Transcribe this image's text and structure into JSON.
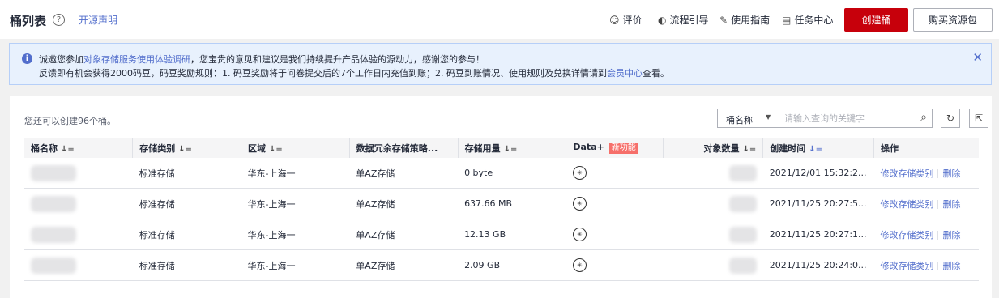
{
  "header": {
    "title": "桶列表",
    "help_icon": "question-circle-icon",
    "open_source_link": "开源声明",
    "toolbar": [
      {
        "icon": "smile-icon",
        "glyph": "☺",
        "label": "评价"
      },
      {
        "icon": "eye-off-icon",
        "glyph": "◐",
        "label": "流程引导"
      },
      {
        "icon": "edit-icon",
        "glyph": "✎",
        "label": "使用指南"
      },
      {
        "icon": "clipboard-icon",
        "glyph": "▤",
        "label": "任务中心"
      }
    ],
    "create_button": "创建桶",
    "buy_button": "购买资源包",
    "accent_color": "#c7000b"
  },
  "notice": {
    "icon": "info-circle-icon",
    "line1_prefix": "诚邀您参加",
    "line1_link": "对象存储服务使用体验调研",
    "line1_suffix": "，您宝贵的意见和建议是我们持续提升产品体验的源动力，感谢您的参与！",
    "line2_prefix": "反馈即有机会获得2000码豆，码豆奖励规则：1. 码豆奖励将于问卷提交后的7个工作日内充值到账；2. 码豆到账情况、使用规则及兑换详情请到",
    "line2_link": "会员中心",
    "line2_suffix": "查看。",
    "close_icon": "close-icon"
  },
  "main": {
    "quota_text": "您还可以创建96个桶。",
    "search": {
      "select_value": "桶名称",
      "placeholder": "请输入查询的关键字"
    },
    "refresh_icon": "refresh-icon",
    "export_icon": "export-icon",
    "columns": [
      {
        "label": "桶名称",
        "sort": "≡"
      },
      {
        "label": "存储类别",
        "sort": "≡"
      },
      {
        "label": "区域",
        "sort": "≡"
      },
      {
        "label": "数据冗余存储策略...",
        "sort": ""
      },
      {
        "label": "存储用量",
        "sort": "≡"
      },
      {
        "label": "Data+",
        "badge": "新功能"
      },
      {
        "label": "对象数量",
        "sort": "≡"
      },
      {
        "label": "创建时间",
        "sort": "≡"
      },
      {
        "label": "操作",
        "sort": ""
      }
    ],
    "rows": [
      {
        "storage_class": "标准存储",
        "region": "华东-上海一",
        "redundancy": "单AZ存储",
        "usage": "0 byte",
        "created": "2021/12/01 15:32:2...",
        "action1": "修改存储类别",
        "action2": "删除"
      },
      {
        "storage_class": "标准存储",
        "region": "华东-上海一",
        "redundancy": "单AZ存储",
        "usage": "637.66 MB",
        "created": "2021/11/25 20:27:5...",
        "action1": "修改存储类别",
        "action2": "删除"
      },
      {
        "storage_class": "标准存储",
        "region": "华东-上海一",
        "redundancy": "单AZ存储",
        "usage": "12.13 GB",
        "created": "2021/11/25 20:27:1...",
        "action1": "修改存储类别",
        "action2": "删除"
      },
      {
        "storage_class": "标准存储",
        "region": "华东-上海一",
        "redundancy": "单AZ存储",
        "usage": "2.09 GB",
        "created": "2021/11/25 20:24:0...",
        "action1": "修改存储类别",
        "action2": "删除"
      }
    ]
  }
}
